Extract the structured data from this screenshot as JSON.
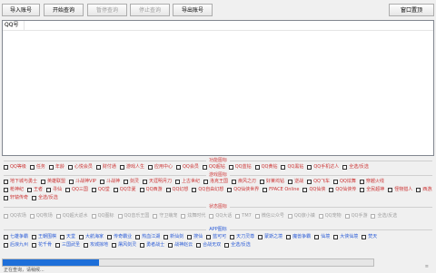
{
  "toolbar": {
    "import": "导入账号",
    "start": "开始查询",
    "pause": "暂停查询",
    "stop": "停止查询",
    "export": "导出账号",
    "window_settings": "窗口置顶"
  },
  "list": {
    "column_header": "QQ号"
  },
  "sections": {
    "features": "功能图标",
    "game": "游戏图标",
    "status": "状态图标",
    "app": "APP图标"
  },
  "rows": {
    "feature": [
      "QQ等级",
      "任务",
      "年龄",
      "心悦会员",
      "财付通",
      "游戏人生",
      "应用中心",
      "QQ会员",
      "QQ超钻",
      "QQ蓝钻",
      "QQ黄钻",
      "QQ黑钻",
      "QQ手机达人",
      "全选/反选"
    ],
    "game1": [
      "地下城与勇士",
      "英雄联盟",
      "斗战神VIP",
      "斗战神",
      "剑灵",
      "天涯明月刀",
      "上古世纪",
      "洛克王国",
      "疾风之刃",
      "好莱坞钻",
      "逆战",
      "QQ飞车",
      "QQ炫舞",
      "穿越火线"
    ],
    "game2": [
      "枪神纪",
      "王者",
      "寻仙",
      "QQ三国",
      "QQ堂",
      "QQ华夏",
      "QQ西游",
      "QQ幻想",
      "QQ自由幻想",
      "QQ仙侠世界",
      "FPACE Online",
      "QQ仙侠",
      "QQ仙侠传",
      "全民超神",
      "怪物猎人",
      "西游之路"
    ],
    "game3": [
      "轩辕传奇",
      "全选/反选"
    ],
    "status": [
      "QQ农场",
      "QQ牧场",
      "QQ超大返水",
      "QQ图标",
      "QQ音乐王国",
      "守卫萌宠",
      "炫舞时代",
      "QQ大话",
      "TM7",
      "微信公众号",
      "QQ旅小镇",
      "QQ宠物",
      "QQ手游",
      "全选/反选"
    ],
    "app1": [
      "七雄争霸",
      "王朝围棋",
      "天堂",
      "大航海家",
      "传奇霸业",
      "热血江湖",
      "新仙剑",
      "搜仙",
      "蓝可可",
      "天刀灵尊",
      "蒙斯之境",
      "魔兽争霸",
      "仙境",
      "大侠仙境",
      "焚天"
    ],
    "app2": [
      "后浪九州",
      "花千骨",
      "三国武圣",
      "攻城掠地",
      "屠风剑灵",
      "勇者战士",
      "战神赵云",
      "合战无双",
      "全选/反选"
    ]
  },
  "progress": {
    "value": 0.26
  },
  "status_bar": {
    "text": "正在查询，请稍候..."
  },
  "grip": "≡"
}
